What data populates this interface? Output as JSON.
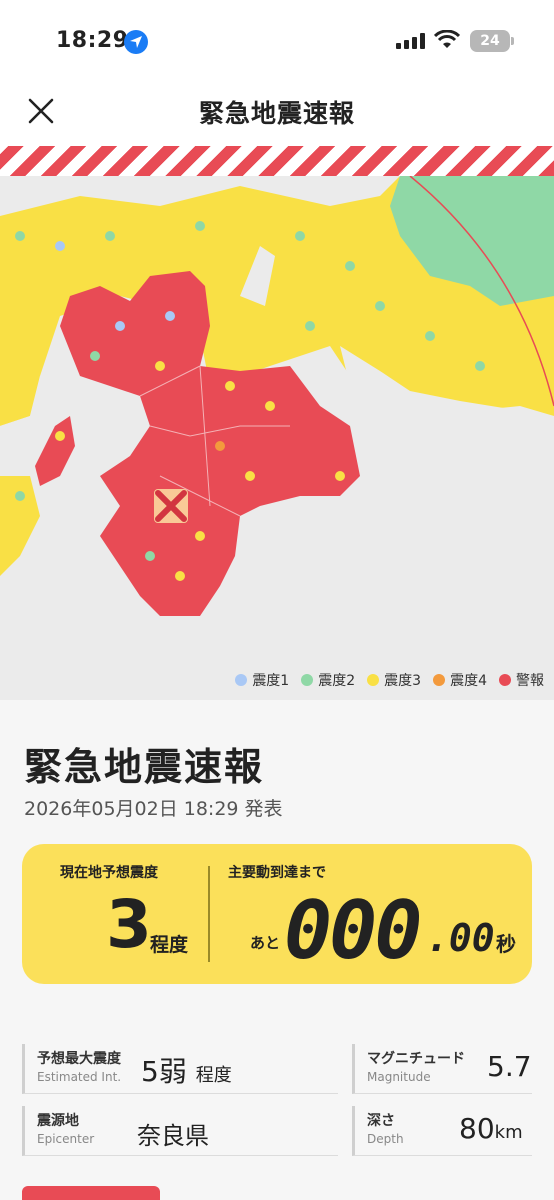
{
  "status_bar": {
    "time": "18:29",
    "battery": "24"
  },
  "nav": {
    "title": "緊急地震速報"
  },
  "legend": [
    {
      "label": "震度1",
      "color": "#a9c8f5"
    },
    {
      "label": "震度2",
      "color": "#8fd8a6"
    },
    {
      "label": "震度3",
      "color": "#f9e045"
    },
    {
      "label": "震度4",
      "color": "#f39a3d"
    },
    {
      "label": "警報",
      "color": "#e84b55"
    }
  ],
  "alert": {
    "title": "緊急地震速報",
    "issued": "2026年05月02日 18:29 発表",
    "local_label": "現在地予想震度",
    "local_value": "3",
    "local_unit": "程度",
    "arrival_label": "主要動到達まで",
    "arrival_prefix": "あと",
    "arrival_main": "000",
    "arrival_decimal": ".00",
    "arrival_unit": "秒"
  },
  "details": {
    "max_int": {
      "label": "予想最大震度",
      "sub": "Estimated Int.",
      "value": "5弱",
      "unit": "程度"
    },
    "magnitude": {
      "label": "マグニチュード",
      "sub": "Magnitude",
      "value": "5.7"
    },
    "epicenter": {
      "label": "震源地",
      "sub": "Epicenter",
      "value": "奈良県"
    },
    "depth": {
      "label": "深さ",
      "sub": "Depth",
      "value": "80",
      "unit": "km"
    }
  }
}
